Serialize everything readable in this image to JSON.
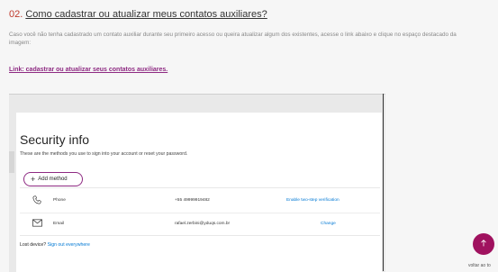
{
  "section": {
    "number": "02.",
    "title": "Como cadastrar ou atualizar meus contatos auxiliares?",
    "description": "Caso você não tenha cadastrado um contato auxiliar durante seu primeiro acesso ou queira atualizar algum dos existentes, acesse o link abaixo e clique no espaço destacado da imagem:",
    "link_label": "Link: cadastrar ou atualizar seus contatos auxiliares."
  },
  "security_info": {
    "title": "Security info",
    "subtitle": "These are the methods you use to sign into your account or reset your password.",
    "add_method_label": "Add method",
    "methods": [
      {
        "icon": "phone-icon",
        "name": "Phone",
        "value": "+55 49999919482",
        "action": "Enable two-step verification"
      },
      {
        "icon": "email-icon",
        "name": "Email",
        "value": "rafael.zerbini@yduqs.com.br",
        "action": "Change"
      }
    ],
    "lost_device_label": "Lost device?",
    "sign_out_label": "Sign out everywhere"
  },
  "back_to_top": {
    "label": "voltar ao to",
    "icon": "arrow-up-icon"
  },
  "colors": {
    "accent": "#8e2a82",
    "fab": "#a0125f",
    "link_blue": "#0078d4",
    "number_red": "#c0392b"
  }
}
